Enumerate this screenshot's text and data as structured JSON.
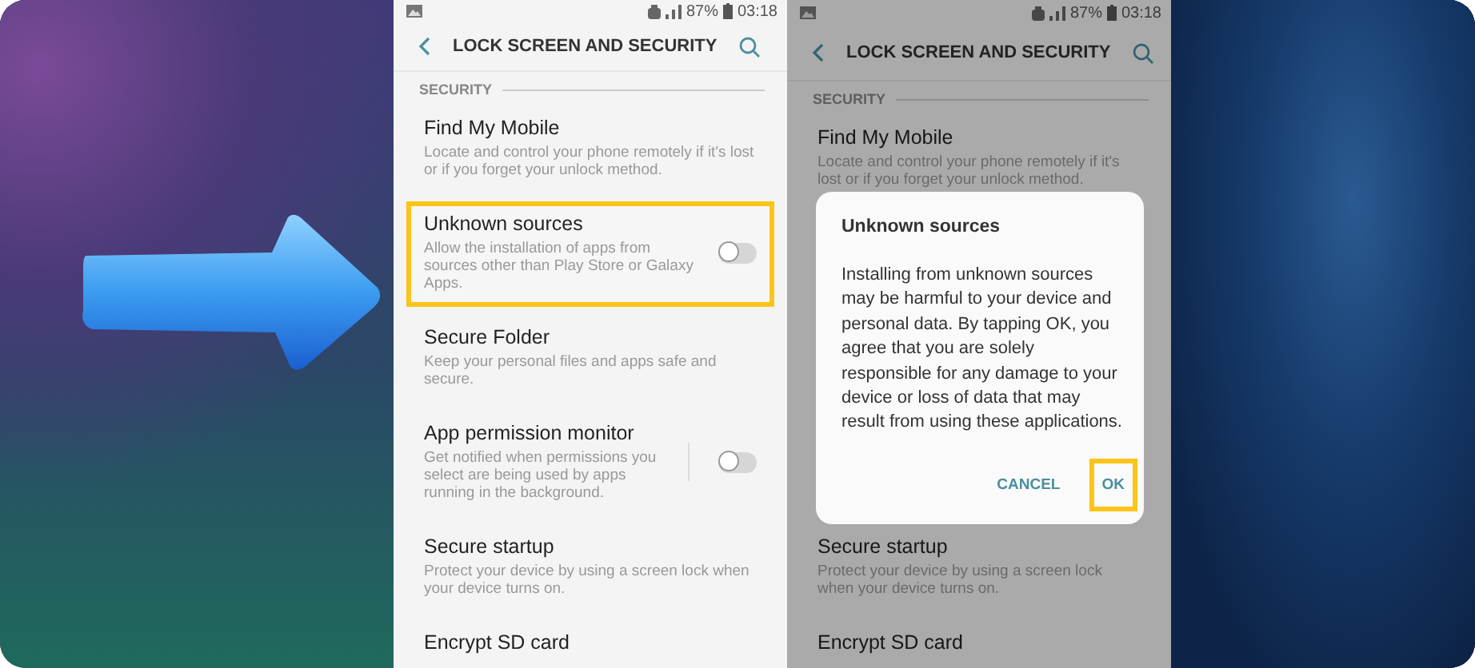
{
  "screens": [
    {
      "dimmed": false,
      "status": {
        "battery": "87%",
        "time": "03:18"
      },
      "title": "LOCK SCREEN AND SECURITY",
      "section": "SECURITY",
      "items": [
        {
          "kind": "plain",
          "title": "Find My Mobile",
          "subtitle": "Locate and control your phone remotely if it's lost or if you forget your unlock method.",
          "highlighted": false
        },
        {
          "kind": "toggle",
          "title": "Unknown sources",
          "subtitle": "Allow the installation of apps from sources other than Play Store or Galaxy Apps.",
          "on": false,
          "highlighted": true
        },
        {
          "kind": "plain",
          "title": "Secure Folder",
          "subtitle": "Keep your personal files and apps safe and secure.",
          "highlighted": false
        },
        {
          "kind": "toggle",
          "title": "App permission monitor",
          "subtitle": "Get notified when permissions you select are being used by apps running in the background.",
          "on": false,
          "highlighted": false
        },
        {
          "kind": "plain",
          "title": "Secure startup",
          "subtitle": "Protect your device by using a screen lock when your device turns on.",
          "highlighted": false
        },
        {
          "kind": "plain",
          "title": "Encrypt SD card",
          "highlighted": false
        }
      ]
    },
    {
      "dimmed": true,
      "status": {
        "battery": "87%",
        "time": "03:18"
      },
      "title": "LOCK SCREEN AND SECURITY",
      "section": "SECURITY",
      "items": [
        {
          "kind": "plain",
          "title": "Find My Mobile",
          "subtitle": "Locate and control your phone remotely if it's lost or if you forget your unlock method.",
          "highlighted": false
        },
        {
          "kind": "plain",
          "title": "Secure startup",
          "subtitle": "Protect your device by using a screen lock when your device turns on.",
          "highlighted": false
        },
        {
          "kind": "plain",
          "title": "Encrypt SD card",
          "highlighted": false
        }
      ],
      "dialog": {
        "title": "Unknown sources",
        "message": "Installing from unknown sources may be harmful to your device and personal data. By tapping OK, you agree that you are solely responsible for any damage to your device or loss of data that may result from using these applications.",
        "buttons": [
          {
            "label": "CANCEL",
            "highlighted": false
          },
          {
            "label": "OK",
            "highlighted": true
          }
        ]
      }
    }
  ]
}
